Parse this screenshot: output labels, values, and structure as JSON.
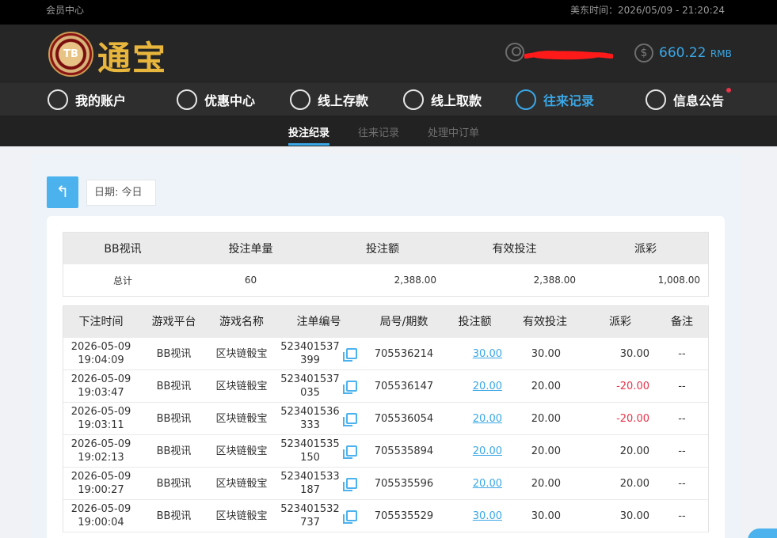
{
  "topbar": {
    "member_center": "会员中心",
    "time_label": "美东时间：2026/05/09 - 21:20:24"
  },
  "header": {
    "logo_chip": "TB",
    "logo_text": "通宝",
    "balance_amount": "660.22",
    "balance_currency": "RMB",
    "accent_color": "#3aa7e6"
  },
  "main_nav": [
    {
      "label": "我的账户",
      "icon": "user-icon"
    },
    {
      "label": "优惠中心",
      "icon": "gift-icon"
    },
    {
      "label": "线上存款",
      "icon": "deposit-icon"
    },
    {
      "label": "线上取款",
      "icon": "withdraw-icon"
    },
    {
      "label": "往来记录",
      "icon": "record-icon",
      "active": true
    },
    {
      "label": "信息公告",
      "icon": "bell-icon"
    }
  ],
  "sub_nav": [
    {
      "label": "投注纪录",
      "active": true
    },
    {
      "label": "往来记录"
    },
    {
      "label": "处理中订单"
    }
  ],
  "filters": {
    "back_icon": "back-arrow-icon",
    "date_label": "日期: 今日"
  },
  "summary": {
    "headers": [
      "BB视讯",
      "投注单量",
      "投注额",
      "有效投注",
      "派彩"
    ],
    "row": [
      "总计",
      "60",
      "2,388.00",
      "2,388.00",
      "1,008.00"
    ]
  },
  "detail": {
    "headers": [
      "下注时间",
      "游戏平台",
      "游戏名称",
      "注单编号",
      "局号/期数",
      "投注额",
      "有效投注",
      "派彩",
      "备注"
    ],
    "rows": [
      {
        "date": "2026-05-09",
        "time": "19:04:09",
        "platform": "BB视讯",
        "game": "区块链骰宝",
        "order_a": "523401537",
        "order_b": "399",
        "round": "705536214",
        "bet": "30.00",
        "valid": "30.00",
        "payout": "30.00",
        "negative": false,
        "note": "--"
      },
      {
        "date": "2026-05-09",
        "time": "19:03:47",
        "platform": "BB视讯",
        "game": "区块链骰宝",
        "order_a": "523401537",
        "order_b": "035",
        "round": "705536147",
        "bet": "20.00",
        "valid": "20.00",
        "payout": "-20.00",
        "negative": true,
        "note": "--"
      },
      {
        "date": "2026-05-09",
        "time": "19:03:11",
        "platform": "BB视讯",
        "game": "区块链骰宝",
        "order_a": "523401536",
        "order_b": "333",
        "round": "705536054",
        "bet": "20.00",
        "valid": "20.00",
        "payout": "-20.00",
        "negative": true,
        "note": "--"
      },
      {
        "date": "2026-05-09",
        "time": "19:02:13",
        "platform": "BB视讯",
        "game": "区块链骰宝",
        "order_a": "523401535",
        "order_b": "150",
        "round": "705535894",
        "bet": "20.00",
        "valid": "20.00",
        "payout": "20.00",
        "negative": false,
        "note": "--"
      },
      {
        "date": "2026-05-09",
        "time": "19:00:27",
        "platform": "BB视讯",
        "game": "区块链骰宝",
        "order_a": "523401533",
        "order_b": "187",
        "round": "705535596",
        "bet": "20.00",
        "valid": "20.00",
        "payout": "20.00",
        "negative": false,
        "note": "--"
      },
      {
        "date": "2026-05-09",
        "time": "19:00:04",
        "platform": "BB视讯",
        "game": "区块链骰宝",
        "order_a": "523401532",
        "order_b": "737",
        "round": "705535529",
        "bet": "30.00",
        "valid": "30.00",
        "payout": "30.00",
        "negative": false,
        "note": "--"
      }
    ]
  }
}
